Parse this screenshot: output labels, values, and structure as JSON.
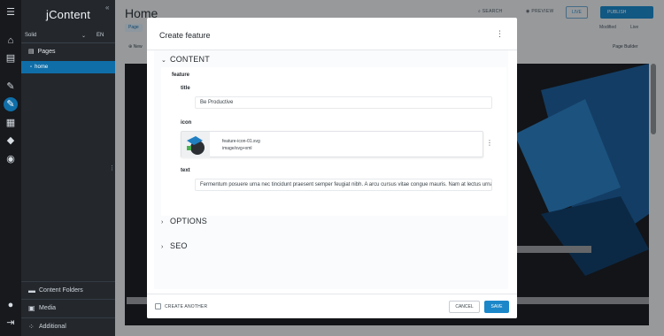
{
  "app": {
    "brand": "jContent",
    "page_title": "Home"
  },
  "sidebar": {
    "site": "Solid",
    "language": "EN",
    "pages_heading": "Pages",
    "home_item": "home",
    "bottom_items": [
      {
        "label": "Content Folders",
        "icon": "folder-icon"
      },
      {
        "label": "Media",
        "icon": "image-icon"
      },
      {
        "label": "Additional",
        "icon": "grid-icon"
      }
    ]
  },
  "header": {
    "search": "SEARCH",
    "preview": "PREVIEW",
    "live": "LIVE",
    "publish": "PUBLISH",
    "page_tag": "Page",
    "status_modified": "Modified",
    "status_live": "Live",
    "new_label": "New",
    "page_builder": "Page Builder"
  },
  "colors": {
    "accent": "#1b87c9",
    "selection": "#0f6ea8",
    "sidebar": "#24282d"
  },
  "modal": {
    "title": "Create feature",
    "sections": {
      "content": "CONTENT",
      "options": "OPTIONS",
      "seo": "SEO"
    },
    "fieldset_label": "feature",
    "fields": {
      "title_label": "title",
      "title_value": "Be Productive",
      "icon_label": "icon",
      "icon_filename": "feature-icon-01.svg",
      "icon_mime": "image/svg+xml",
      "text_label": "text",
      "text_value": "Fermentum posuere urna nec tincidunt praesent semper feugiat nibh. A arcu cursus vitae congue mauris. Nam at lectus urna dui"
    },
    "footer": {
      "create_another": "CREATE ANOTHER",
      "cancel": "CANCEL",
      "save": "SAVE"
    }
  }
}
